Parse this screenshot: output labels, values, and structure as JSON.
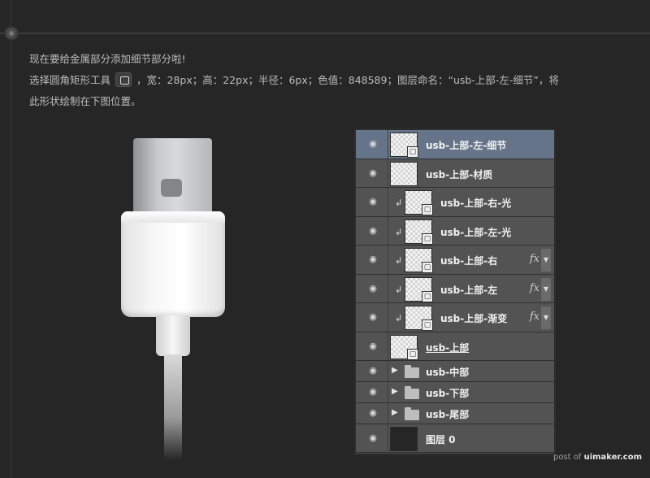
{
  "instructions": {
    "line1": "现在要给金属部分添加细节部分啦!",
    "line2_prefix": "选择圆角矩形工具",
    "line2_suffix": "，宽：28px；高：22px；半径：6px；色值：848589；图层命名：“usb-上部-左-细节”，将",
    "line3": "此形状绘制在下图位置。"
  },
  "colors": {
    "detail_color": "#848589",
    "selected_layer": "#667489"
  },
  "layers": [
    {
      "name": "usb-上部-左-细节",
      "selected": true,
      "clipped": false,
      "fx": false,
      "type": "shape"
    },
    {
      "name": "usb-上部-材质",
      "selected": false,
      "clipped": false,
      "fx": false,
      "type": "texture"
    },
    {
      "name": "usb-上部-右-光",
      "selected": false,
      "clipped": true,
      "fx": false,
      "type": "shape"
    },
    {
      "name": "usb-上部-左-光",
      "selected": false,
      "clipped": true,
      "fx": false,
      "type": "shape"
    },
    {
      "name": "usb-上部-右",
      "selected": false,
      "clipped": true,
      "fx": true,
      "type": "shape"
    },
    {
      "name": "usb-上部-左",
      "selected": false,
      "clipped": true,
      "fx": true,
      "type": "shape"
    },
    {
      "name": "usb-上部-渐变",
      "selected": false,
      "clipped": true,
      "fx": true,
      "type": "shape"
    },
    {
      "name": "usb-上部",
      "selected": false,
      "clipped": false,
      "fx": false,
      "type": "shape",
      "underline": true
    },
    {
      "name": "usb-中部",
      "selected": false,
      "type": "group"
    },
    {
      "name": "usb-下部",
      "selected": false,
      "type": "group"
    },
    {
      "name": "usb-尾部",
      "selected": false,
      "type": "group"
    },
    {
      "name": "图层 0",
      "selected": false,
      "type": "fill"
    }
  ],
  "icons": {
    "eye": "👁",
    "clip": "↲",
    "fx": "fx",
    "expand": "▶",
    "fx_arrow": "▼"
  },
  "footer": {
    "prefix": "post of ",
    "brand": "uimaker.com"
  }
}
